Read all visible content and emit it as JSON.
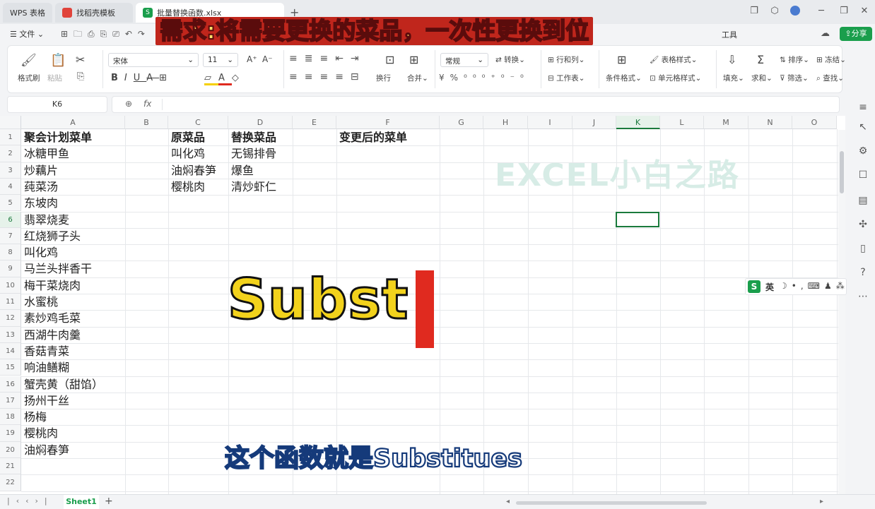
{
  "window": {
    "tabs": [
      {
        "label": "WPS 表格"
      },
      {
        "label": "找稻壳模板"
      },
      {
        "label": "批量替换函数.xlsx"
      }
    ],
    "new_tab": "+"
  },
  "menubar": {
    "file_label": "文件",
    "tools_label": "工具",
    "share_label": "分享"
  },
  "ribbon": {
    "format_painter": "格式刷",
    "paste": "粘贴",
    "font_name": "宋体",
    "font_size": "11",
    "font_grow": "A⁺",
    "font_shrink": "A⁻",
    "number_format": "常规",
    "convert": "转换",
    "wrap": "换行",
    "merge": "合并",
    "rows_cols": "行和列",
    "worksheet": "工作表",
    "cond_format": "条件格式",
    "table_style": "表格样式",
    "cell_style": "单元格样式",
    "fill": "填充",
    "sum": "求和",
    "sort": "排序",
    "filter": "筛选",
    "freeze": "冻结",
    "find": "查找"
  },
  "formula_bar": {
    "name_box": "K6",
    "fx": "fx",
    "formula": ""
  },
  "sheet": {
    "columns": [
      "A",
      "B",
      "C",
      "D",
      "E",
      "F",
      "G",
      "H",
      "I",
      "J",
      "K",
      "L",
      "M",
      "N",
      "O"
    ],
    "rows": [
      "1",
      "2",
      "3",
      "4",
      "5",
      "6",
      "7",
      "8",
      "9",
      "10",
      "11",
      "12",
      "13",
      "14",
      "15",
      "16",
      "17",
      "18",
      "19",
      "20",
      "21",
      "22"
    ],
    "col_a": [
      "聚会计划菜单",
      "冰糖甲鱼",
      "炒藕片",
      "莼菜汤",
      "东坡肉",
      "翡翠烧麦",
      "红烧狮子头",
      "叫化鸡",
      "马兰头拌香干",
      "梅干菜烧肉",
      "水蜜桃",
      "素炒鸡毛菜",
      "西湖牛肉羹",
      "香菇青菜",
      "响油鳝糊",
      "蟹壳黄（甜馅）",
      "扬州干丝",
      "杨梅",
      "樱桃肉",
      "油焖春笋"
    ],
    "col_c": [
      "原菜品",
      "叫化鸡",
      "油焖春笋",
      "樱桃肉"
    ],
    "col_d": [
      "替换菜品",
      "无锡排骨",
      "爆鱼",
      "清炒虾仁"
    ],
    "f1": "变更后的菜单",
    "selected_cell": "K6",
    "sheet_tab": "Sheet1"
  },
  "overlay": {
    "headline": "需求:将需要更换的菜品，一次性更换到位",
    "typing": "Subst",
    "subtitle": "这个函数就是Substitues",
    "watermark": "EXCEL小白之路",
    "ime_label": "英"
  },
  "colors": {
    "accent_green": "#1a9e4c",
    "headline_bg": "#c0261c",
    "headline_text": "#ffe26b",
    "typing_text": "#f2d21c",
    "cursor": "#e02a1f"
  }
}
